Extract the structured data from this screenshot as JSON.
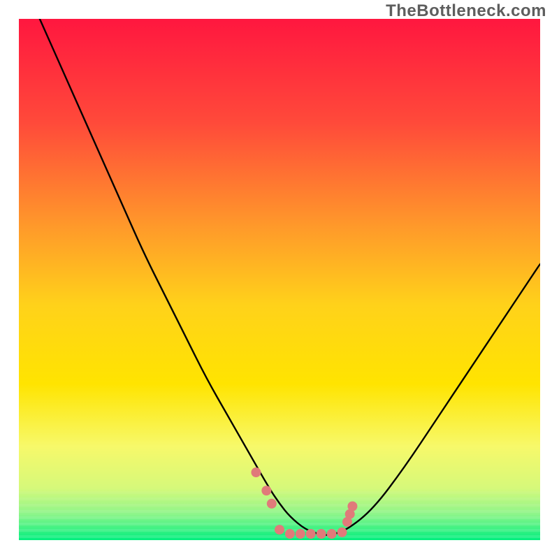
{
  "watermark": "TheBottleneck.com",
  "chart_data": {
    "type": "line",
    "title": "",
    "xlabel": "",
    "ylabel": "",
    "xlim": [
      0,
      100
    ],
    "ylim": [
      0,
      100
    ],
    "legend": false,
    "grid": false,
    "background_gradient": {
      "top_color": "#ff173f",
      "mid_color": "#ffe400",
      "bottom_color": "#00ef7e"
    },
    "series": [
      {
        "name": "curve",
        "color": "#000000",
        "x": [
          4,
          8,
          12,
          16,
          20,
          24,
          28,
          32,
          36,
          40,
          44,
          48,
          50,
          52,
          55,
          58,
          60,
          63,
          68,
          74,
          80,
          86,
          92,
          100
        ],
        "y": [
          100,
          91,
          82,
          73,
          64,
          55,
          47,
          39,
          31,
          24,
          17,
          10,
          7,
          4.5,
          2,
          1,
          1,
          2,
          6,
          14,
          23,
          32,
          41,
          53
        ]
      }
    ],
    "markers": [
      {
        "name": "dots",
        "color": "#e07a7a",
        "shape": "circle",
        "x": [
          45.5,
          47.5,
          48.5,
          50.0,
          52.0,
          54.0,
          56.0,
          58.0,
          60.0,
          62.0,
          63.0,
          63.5,
          64.0
        ],
        "y": [
          13.0,
          9.5,
          7.0,
          2.0,
          1.2,
          1.2,
          1.2,
          1.2,
          1.2,
          1.5,
          3.5,
          5.0,
          6.5
        ]
      }
    ]
  }
}
